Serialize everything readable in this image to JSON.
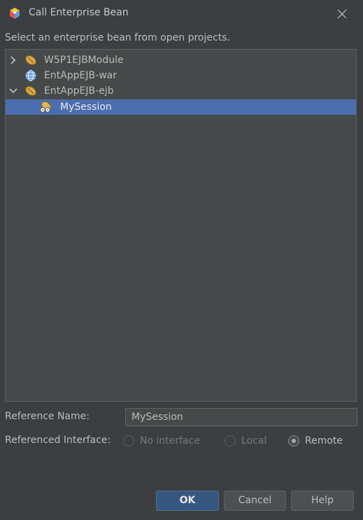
{
  "window": {
    "title": "Call Enterprise Bean",
    "icon": "netbeans-cube-icon",
    "close_icon": "close-icon"
  },
  "instruction": "Select an enterprise bean from open projects.",
  "tree": {
    "items": [
      {
        "label": "W5P1EJBModule",
        "icon": "ejb-module-icon",
        "expander": "chevron-right-icon",
        "depth": 0
      },
      {
        "label": "EntAppEJB-war",
        "icon": "web-module-icon",
        "expander": "",
        "depth": 0
      },
      {
        "label": "EntAppEJB-ejb",
        "icon": "ejb-module-icon",
        "expander": "chevron-down-icon",
        "depth": 0
      },
      {
        "label": "MySession",
        "icon": "session-bean-icon",
        "expander": "",
        "depth": 1,
        "selected": true
      }
    ]
  },
  "form": {
    "reference_name_label": "Reference Name:",
    "reference_name_value": "MySession",
    "referenced_interface_label": "Referenced Interface:",
    "interface_options": [
      {
        "label": "No interface",
        "checked": false,
        "enabled": false
      },
      {
        "label": "Local",
        "checked": false,
        "enabled": false
      },
      {
        "label": "Remote",
        "checked": true,
        "enabled": true
      }
    ]
  },
  "buttons": {
    "ok": "OK",
    "cancel": "Cancel",
    "help": "Help"
  },
  "colors": {
    "background": "#3c3f41",
    "selection": "#4b6eaf",
    "primary_button": "#365880"
  }
}
